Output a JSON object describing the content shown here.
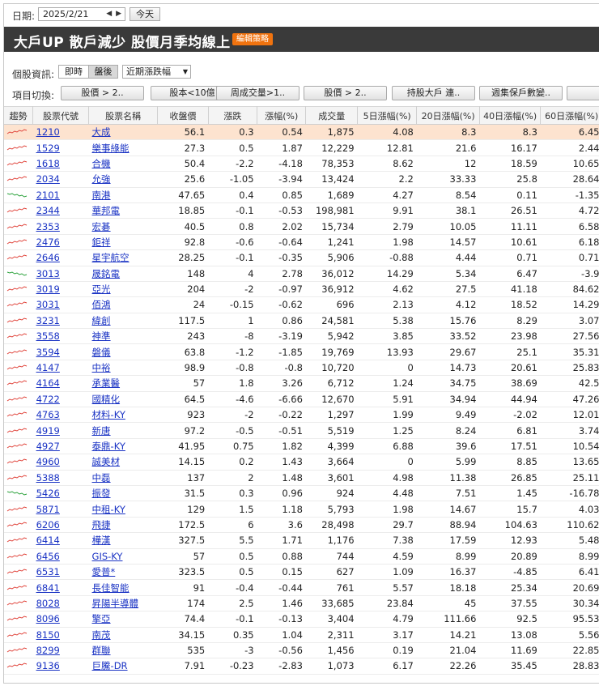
{
  "date": {
    "label": "日期:",
    "value": "2025/2/21",
    "today": "今天"
  },
  "title": "大戶UP 散戶減少  股價月季均線上",
  "edit_button": "編輯策略",
  "info": {
    "label": "個股資訊:",
    "seg_realtime": "即時",
    "seg_after": "盤後",
    "period_select": "近期漲跌幅"
  },
  "switch": {
    "label": "項目切換:",
    "buttons": [
      "股價 > 2..",
      "股本<10億",
      "周成交量>1..",
      "股價 > 2..",
      "持股大戶 連..",
      "週集保戶數變..",
      "散戶"
    ]
  },
  "table": {
    "headers": [
      "趨勢",
      "股票代號",
      "股票名稱",
      "收盤價",
      "漲跌",
      "漲幅(%)",
      "成交量",
      "5日漲幅(%)",
      "20日漲幅(%)",
      "40日漲幅(%)",
      "60日漲幅(%)"
    ],
    "trend_colors": {
      "up": "#e0433a",
      "down": "#2aa13a"
    },
    "rows": [
      {
        "code": "1210",
        "name": "大成",
        "close": "56.1",
        "chg": "0.3",
        "pct": "0.54",
        "vol": "1,875",
        "d5": "4.08",
        "d20": "8.3",
        "d40": "8.3",
        "d60": "6.45",
        "trend": "up"
      },
      {
        "code": "1529",
        "name": "樂事綠能",
        "close": "27.3",
        "chg": "0.5",
        "pct": "1.87",
        "vol": "12,229",
        "d5": "12.81",
        "d20": "21.6",
        "d40": "16.17",
        "d60": "2.44",
        "trend": "up"
      },
      {
        "code": "1618",
        "name": "合機",
        "close": "50.4",
        "chg": "-2.2",
        "pct": "-4.18",
        "vol": "78,353",
        "d5": "8.62",
        "d20": "12",
        "d40": "18.59",
        "d60": "10.65",
        "trend": "up"
      },
      {
        "code": "2034",
        "name": "允強",
        "close": "25.6",
        "chg": "-1.05",
        "pct": "-3.94",
        "vol": "13,424",
        "d5": "2.2",
        "d20": "33.33",
        "d40": "25.8",
        "d60": "28.64",
        "trend": "up"
      },
      {
        "code": "2101",
        "name": "南港",
        "close": "47.65",
        "chg": "0.4",
        "pct": "0.85",
        "vol": "1,689",
        "d5": "4.27",
        "d20": "8.54",
        "d40": "0.11",
        "d60": "-1.35",
        "trend": "down"
      },
      {
        "code": "2344",
        "name": "華邦電",
        "close": "18.85",
        "chg": "-0.1",
        "pct": "-0.53",
        "vol": "198,981",
        "d5": "9.91",
        "d20": "38.1",
        "d40": "26.51",
        "d60": "4.72",
        "trend": "up"
      },
      {
        "code": "2353",
        "name": "宏碁",
        "close": "40.5",
        "chg": "0.8",
        "pct": "2.02",
        "vol": "15,734",
        "d5": "2.79",
        "d20": "10.05",
        "d40": "11.11",
        "d60": "6.58",
        "trend": "up"
      },
      {
        "code": "2476",
        "name": "鉅祥",
        "close": "92.8",
        "chg": "-0.6",
        "pct": "-0.64",
        "vol": "1,241",
        "d5": "1.98",
        "d20": "14.57",
        "d40": "10.61",
        "d60": "6.18",
        "trend": "up"
      },
      {
        "code": "2646",
        "name": "星宇航空",
        "close": "28.25",
        "chg": "-0.1",
        "pct": "-0.35",
        "vol": "5,906",
        "d5": "-0.88",
        "d20": "4.44",
        "d40": "0.71",
        "d60": "0.71",
        "trend": "up"
      },
      {
        "code": "3013",
        "name": "晟銘電",
        "close": "148",
        "chg": "4",
        "pct": "2.78",
        "vol": "36,012",
        "d5": "14.29",
        "d20": "5.34",
        "d40": "6.47",
        "d60": "-3.9",
        "trend": "down"
      },
      {
        "code": "3019",
        "name": "亞光",
        "close": "204",
        "chg": "-2",
        "pct": "-0.97",
        "vol": "36,912",
        "d5": "4.62",
        "d20": "27.5",
        "d40": "41.18",
        "d60": "84.62",
        "trend": "up"
      },
      {
        "code": "3031",
        "name": "佰鴻",
        "close": "24",
        "chg": "-0.15",
        "pct": "-0.62",
        "vol": "696",
        "d5": "2.13",
        "d20": "4.12",
        "d40": "18.52",
        "d60": "14.29",
        "trend": "up"
      },
      {
        "code": "3231",
        "name": "緯創",
        "close": "117.5",
        "chg": "1",
        "pct": "0.86",
        "vol": "24,581",
        "d5": "5.38",
        "d20": "15.76",
        "d40": "8.29",
        "d60": "3.07",
        "trend": "up"
      },
      {
        "code": "3558",
        "name": "神準",
        "close": "243",
        "chg": "-8",
        "pct": "-3.19",
        "vol": "5,942",
        "d5": "3.85",
        "d20": "33.52",
        "d40": "23.98",
        "d60": "27.56",
        "trend": "up"
      },
      {
        "code": "3594",
        "name": "磐儀",
        "close": "63.8",
        "chg": "-1.2",
        "pct": "-1.85",
        "vol": "19,769",
        "d5": "13.93",
        "d20": "29.67",
        "d40": "25.1",
        "d60": "35.31",
        "trend": "up"
      },
      {
        "code": "4147",
        "name": "中裕",
        "close": "98.9",
        "chg": "-0.8",
        "pct": "-0.8",
        "vol": "10,720",
        "d5": "0",
        "d20": "14.73",
        "d40": "20.61",
        "d60": "25.83",
        "trend": "up"
      },
      {
        "code": "4164",
        "name": "承業醫",
        "close": "57",
        "chg": "1.8",
        "pct": "3.26",
        "vol": "6,712",
        "d5": "1.24",
        "d20": "34.75",
        "d40": "38.69",
        "d60": "42.5",
        "trend": "up"
      },
      {
        "code": "4722",
        "name": "國精化",
        "close": "64.5",
        "chg": "-4.6",
        "pct": "-6.66",
        "vol": "12,670",
        "d5": "5.91",
        "d20": "34.94",
        "d40": "44.94",
        "d60": "47.26",
        "trend": "up"
      },
      {
        "code": "4763",
        "name": "材料-KY",
        "close": "923",
        "chg": "-2",
        "pct": "-0.22",
        "vol": "1,297",
        "d5": "1.99",
        "d20": "9.49",
        "d40": "-2.02",
        "d60": "12.01",
        "trend": "up"
      },
      {
        "code": "4919",
        "name": "新唐",
        "close": "97.2",
        "chg": "-0.5",
        "pct": "-0.51",
        "vol": "5,519",
        "d5": "1.25",
        "d20": "8.24",
        "d40": "6.81",
        "d60": "3.74",
        "trend": "up"
      },
      {
        "code": "4927",
        "name": "泰鼎-KY",
        "close": "41.95",
        "chg": "0.75",
        "pct": "1.82",
        "vol": "4,399",
        "d5": "6.88",
        "d20": "39.6",
        "d40": "17.51",
        "d60": "10.54",
        "trend": "up"
      },
      {
        "code": "4960",
        "name": "誠美材",
        "close": "14.15",
        "chg": "0.2",
        "pct": "1.43",
        "vol": "3,664",
        "d5": "0",
        "d20": "5.99",
        "d40": "8.85",
        "d60": "13.65",
        "trend": "up"
      },
      {
        "code": "5388",
        "name": "中磊",
        "close": "137",
        "chg": "2",
        "pct": "1.48",
        "vol": "3,601",
        "d5": "4.98",
        "d20": "11.38",
        "d40": "26.85",
        "d60": "25.11",
        "trend": "up"
      },
      {
        "code": "5426",
        "name": "振發",
        "close": "31.5",
        "chg": "0.3",
        "pct": "0.96",
        "vol": "924",
        "d5": "4.48",
        "d20": "7.51",
        "d40": "1.45",
        "d60": "-16.78",
        "trend": "down"
      },
      {
        "code": "5871",
        "name": "中租-KY",
        "close": "129",
        "chg": "1.5",
        "pct": "1.18",
        "vol": "5,793",
        "d5": "1.98",
        "d20": "14.67",
        "d40": "15.7",
        "d60": "4.03",
        "trend": "up"
      },
      {
        "code": "6206",
        "name": "飛捷",
        "close": "172.5",
        "chg": "6",
        "pct": "3.6",
        "vol": "28,498",
        "d5": "29.7",
        "d20": "88.94",
        "d40": "104.63",
        "d60": "110.62",
        "trend": "up"
      },
      {
        "code": "6414",
        "name": "樺漢",
        "close": "327.5",
        "chg": "5.5",
        "pct": "1.71",
        "vol": "1,176",
        "d5": "7.38",
        "d20": "17.59",
        "d40": "12.93",
        "d60": "5.48",
        "trend": "up"
      },
      {
        "code": "6456",
        "name": "GIS-KY",
        "close": "57",
        "chg": "0.5",
        "pct": "0.88",
        "vol": "744",
        "d5": "4.59",
        "d20": "8.99",
        "d40": "20.89",
        "d60": "8.99",
        "trend": "up"
      },
      {
        "code": "6531",
        "name": "愛普*",
        "close": "323.5",
        "chg": "0.5",
        "pct": "0.15",
        "vol": "627",
        "d5": "1.09",
        "d20": "16.37",
        "d40": "-4.85",
        "d60": "6.41",
        "trend": "up"
      },
      {
        "code": "6841",
        "name": "長佳智能",
        "close": "91",
        "chg": "-0.4",
        "pct": "-0.44",
        "vol": "761",
        "d5": "5.57",
        "d20": "18.18",
        "d40": "25.34",
        "d60": "20.69",
        "trend": "up"
      },
      {
        "code": "8028",
        "name": "昇陽半導體",
        "close": "174",
        "chg": "2.5",
        "pct": "1.46",
        "vol": "33,685",
        "d5": "23.84",
        "d20": "45",
        "d40": "37.55",
        "d60": "30.34",
        "trend": "up"
      },
      {
        "code": "8096",
        "name": "擎亞",
        "close": "74.4",
        "chg": "-0.1",
        "pct": "-0.13",
        "vol": "3,404",
        "d5": "4.79",
        "d20": "111.66",
        "d40": "92.5",
        "d60": "95.53",
        "trend": "up"
      },
      {
        "code": "8150",
        "name": "南茂",
        "close": "34.15",
        "chg": "0.35",
        "pct": "1.04",
        "vol": "2,311",
        "d5": "3.17",
        "d20": "14.21",
        "d40": "13.08",
        "d60": "5.56",
        "trend": "up"
      },
      {
        "code": "8299",
        "name": "群聯",
        "close": "535",
        "chg": "-3",
        "pct": "-0.56",
        "vol": "1,456",
        "d5": "0.19",
        "d20": "21.04",
        "d40": "11.69",
        "d60": "22.85",
        "trend": "up"
      },
      {
        "code": "9136",
        "name": "巨騰-DR",
        "close": "7.91",
        "chg": "-0.23",
        "pct": "-2.83",
        "vol": "1,073",
        "d5": "6.17",
        "d20": "22.26",
        "d40": "35.45",
        "d60": "28.83",
        "trend": "up"
      }
    ]
  }
}
